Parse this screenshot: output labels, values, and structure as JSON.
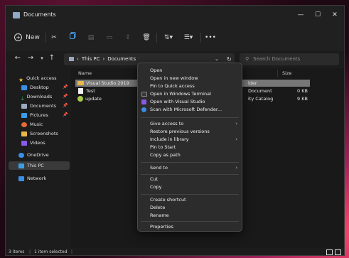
{
  "window": {
    "title": "Documents"
  },
  "titlebar": {
    "minimize": "—",
    "maximize": "☐",
    "close": "✕"
  },
  "toolbar": {
    "new_label": "New",
    "new_icon": "plus-circle-icon",
    "more": "•••"
  },
  "address": {
    "path_root": "This PC",
    "path_current": "Documents",
    "search_placeholder": "Search Documents"
  },
  "sidebar": {
    "items": [
      {
        "label": "Quick access",
        "icon": "star-icon",
        "color": "#f3c13a"
      },
      {
        "label": "Desktop",
        "icon": "desktop-icon",
        "color": "#3a8ee6"
      },
      {
        "label": "Downloads",
        "icon": "download-icon",
        "color": "#3ab06a"
      },
      {
        "label": "Documents",
        "icon": "documents-icon",
        "color": "#9aa9bd"
      },
      {
        "label": "Pictures",
        "icon": "pictures-icon",
        "color": "#3a9ae6"
      },
      {
        "label": "Music",
        "icon": "music-icon",
        "color": "#e66a3a"
      },
      {
        "label": "Screenshots",
        "icon": "folder-icon",
        "color": "#e8b84a"
      },
      {
        "label": "Videos",
        "icon": "videos-icon",
        "color": "#8a5ae6"
      },
      {
        "label": "OneDrive",
        "icon": "cloud-icon",
        "color": "#3a8ee6"
      },
      {
        "label": "This PC",
        "icon": "computer-icon",
        "color": "#3aa0e6"
      },
      {
        "label": "Network",
        "icon": "network-icon",
        "color": "#3a8ee6"
      }
    ]
  },
  "columns": {
    "name": "Name",
    "size": "Size"
  },
  "files": [
    {
      "name": "Visual Studio 2019",
      "type": "lder",
      "size": ""
    },
    {
      "name": "Test",
      "type": "Document",
      "size": "0 KB"
    },
    {
      "name": "update",
      "type": "ity Catalog",
      "size": "9 KB"
    }
  ],
  "context_menu": {
    "items": [
      {
        "label": "Open"
      },
      {
        "label": "Open in new window"
      },
      {
        "label": "Pin to Quick access"
      },
      {
        "label": "Open in Windows Terminal"
      },
      {
        "label": "Open with Visual Studio"
      },
      {
        "label": "Scan with Microsoft Defender..."
      },
      {
        "label": "Give access to",
        "submenu": true
      },
      {
        "label": "Restore previous versions"
      },
      {
        "label": "Include in library",
        "submenu": true
      },
      {
        "label": "Pin to Start"
      },
      {
        "label": "Copy as path"
      },
      {
        "label": "Send to",
        "submenu": true
      },
      {
        "label": "Cut"
      },
      {
        "label": "Copy"
      },
      {
        "label": "Create shortcut"
      },
      {
        "label": "Delete"
      },
      {
        "label": "Rename"
      },
      {
        "label": "Properties"
      }
    ]
  },
  "status": {
    "items": "3 items",
    "selected": "1 item selected"
  },
  "colors": {
    "accent": "#3a8ee6",
    "selection": "#777777",
    "menu_bg": "#2c2c2c"
  }
}
